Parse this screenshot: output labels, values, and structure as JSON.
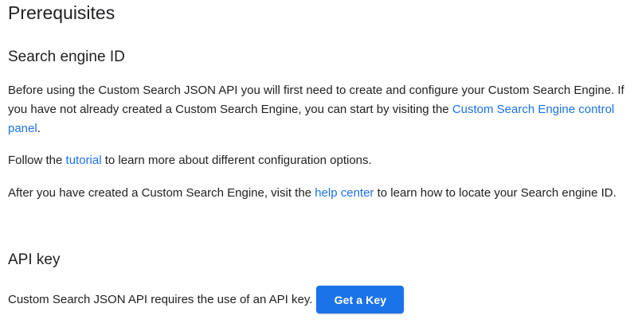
{
  "prerequisites": {
    "title": "Prerequisites"
  },
  "search_engine": {
    "heading": "Search engine ID",
    "para1_text": "Before using the Custom Search JSON API you will first need to create and configure your Custom Search Engine. If you have not already created a Custom Search Engine, you can start by visiting the ",
    "para1_link": "Custom Search Engine control panel",
    "para1_end": ".",
    "para2_start": "Follow the ",
    "para2_link": "tutorial",
    "para2_end": " to learn more about different configuration options.",
    "para3_start": "After you have created a Custom Search Engine, visit the ",
    "para3_link": "help center",
    "para3_end": " to learn how to locate your Search engine ID."
  },
  "api_key": {
    "heading": "API key",
    "text": "Custom Search JSON API requires the use of an API key.",
    "button_label": "Get a Key"
  },
  "colors": {
    "link": "#1a73e8",
    "button_bg": "#1a73e8",
    "text": "#202124"
  }
}
